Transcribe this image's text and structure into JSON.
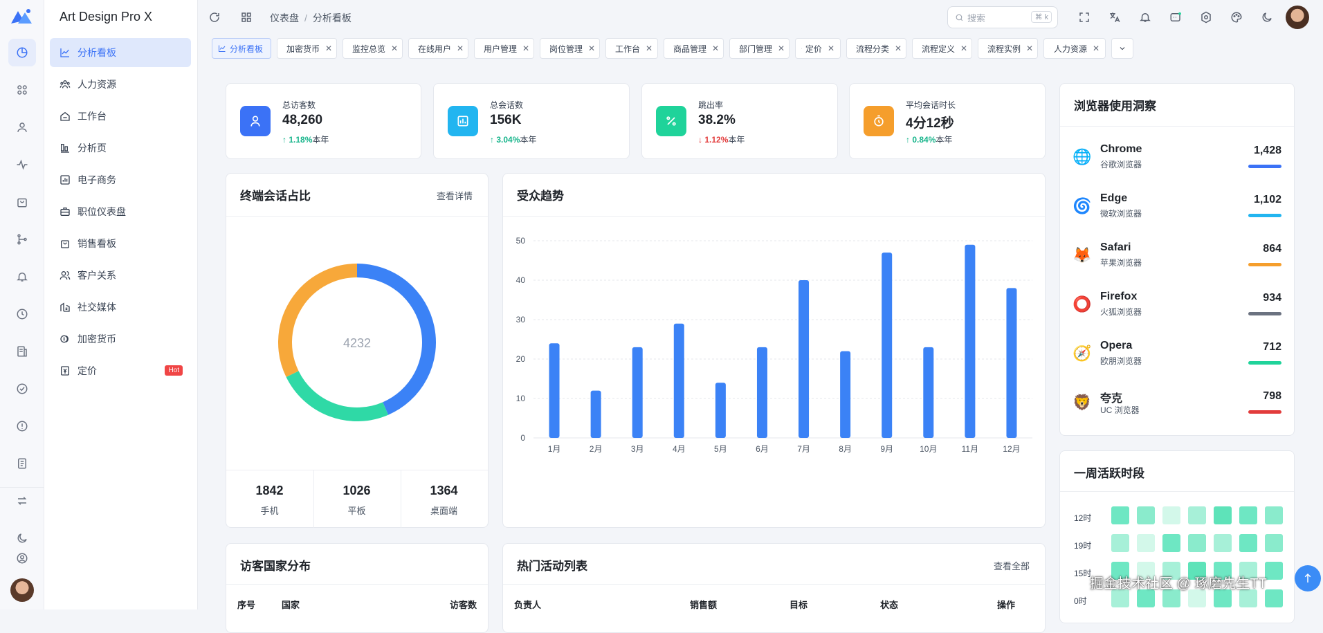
{
  "app": {
    "title": "Art Design Pro X"
  },
  "sidebar": {
    "items": [
      {
        "label": "分析看板",
        "active": true
      },
      {
        "label": "人力资源"
      },
      {
        "label": "工作台"
      },
      {
        "label": "分析页"
      },
      {
        "label": "电子商务"
      },
      {
        "label": "职位仪表盘"
      },
      {
        "label": "销售看板"
      },
      {
        "label": "客户关系"
      },
      {
        "label": "社交媒体"
      },
      {
        "label": "加密货币"
      },
      {
        "label": "定价",
        "badge": "Hot"
      }
    ]
  },
  "header": {
    "breadcrumb": [
      "仪表盘",
      "分析看板"
    ],
    "search_placeholder": "搜索",
    "search_shortcut": "⌘ k"
  },
  "tabs": [
    {
      "label": "分析看板",
      "icon": "chart-line-icon",
      "active": true
    },
    {
      "label": "加密货币",
      "icon": "coin-icon"
    },
    {
      "label": "监控总览",
      "icon": "grid-icon"
    },
    {
      "label": "在线用户",
      "icon": "user-icon"
    },
    {
      "label": "用户管理",
      "icon": "user-icon"
    },
    {
      "label": "岗位管理",
      "icon": "briefcase-icon"
    },
    {
      "label": "工作台",
      "icon": "home-icon"
    },
    {
      "label": "商品管理",
      "icon": "tag-icon"
    },
    {
      "label": "部门管理",
      "icon": "building-icon"
    },
    {
      "label": "定价",
      "icon": "price-icon"
    },
    {
      "label": "流程分类",
      "icon": "tag-icon"
    },
    {
      "label": "流程定义",
      "icon": "flow-icon"
    },
    {
      "label": "流程实例",
      "icon": "flow-icon"
    },
    {
      "label": "人力资源",
      "icon": "users-icon"
    }
  ],
  "stats": [
    {
      "label": "总访客数",
      "value": "48,260",
      "change": "1.18%",
      "suffix": "本年",
      "dir": "up",
      "color": "#3b72f6"
    },
    {
      "label": "总会话数",
      "value": "156K",
      "change": "3.04%",
      "suffix": "本年",
      "dir": "up",
      "color": "#22b5f0"
    },
    {
      "label": "跳出率",
      "value": "38.2%",
      "change": "1.12%",
      "suffix": "本年",
      "dir": "down",
      "color": "#1fd39a"
    },
    {
      "label": "平均会话时长",
      "value": "4分12秒",
      "change": "0.84%",
      "suffix": "本年",
      "dir": "up",
      "color": "#f59e2c"
    }
  ],
  "donut": {
    "title": "终端会话占比",
    "link": "查看详情",
    "center": "4232",
    "segments": [
      {
        "name": "手机",
        "value": 1842,
        "color": "#3b82f6"
      },
      {
        "name": "平板",
        "value": 1026,
        "color": "#2fd9a6"
      },
      {
        "name": "桌面端",
        "value": 1364,
        "color": "#f7a83a"
      }
    ]
  },
  "device_stats": [
    {
      "value": "1842",
      "label": "手机"
    },
    {
      "value": "1026",
      "label": "平板"
    },
    {
      "value": "1364",
      "label": "桌面端"
    }
  ],
  "chart_data": {
    "type": "bar",
    "title": "受众趋势",
    "categories": [
      "1月",
      "2月",
      "3月",
      "4月",
      "5月",
      "6月",
      "7月",
      "8月",
      "9月",
      "10月",
      "11月",
      "12月"
    ],
    "values": [
      24,
      12,
      23,
      29,
      14,
      23,
      40,
      22,
      47,
      23,
      49,
      38
    ],
    "ylim": [
      0,
      50
    ],
    "yticks": [
      0,
      10,
      20,
      30,
      40,
      50
    ],
    "grid": true,
    "color": "#3b82f6"
  },
  "browsers": {
    "title": "浏览器使用洞察",
    "items": [
      {
        "name": "Chrome",
        "sub": "谷歌浏览器",
        "value": "1,428",
        "color": "#3b72f6",
        "icon": "🌐"
      },
      {
        "name": "Edge",
        "sub": "微软浏览器",
        "value": "1,102",
        "color": "#22b5f0",
        "icon": "🌀"
      },
      {
        "name": "Safari",
        "sub": "苹果浏览器",
        "value": "864",
        "color": "#f59e2c",
        "icon": "🦊"
      },
      {
        "name": "Firefox",
        "sub": "火狐浏览器",
        "value": "934",
        "color": "#6b7280",
        "icon": "⭕"
      },
      {
        "name": "Opera",
        "sub": "欧朋浏览器",
        "value": "712",
        "color": "#1fd39a",
        "icon": "🧭"
      },
      {
        "name": "夸克",
        "sub": "UC 浏览器",
        "value": "798",
        "color": "#e23b3b",
        "icon": "🦁"
      }
    ]
  },
  "weekly": {
    "title": "一周活跃时段",
    "rows": [
      "12时",
      "19时",
      "15时",
      "0时"
    ]
  },
  "countries": {
    "title": "访客国家分布",
    "columns": [
      "序号",
      "国家",
      "访客数"
    ]
  },
  "activities": {
    "title": "热门活动列表",
    "link": "查看全部",
    "columns": [
      "负责人",
      "销售额",
      "目标",
      "状态",
      "操作"
    ]
  },
  "watermark": "掘金技术社区 @ 琢磨先生TT"
}
